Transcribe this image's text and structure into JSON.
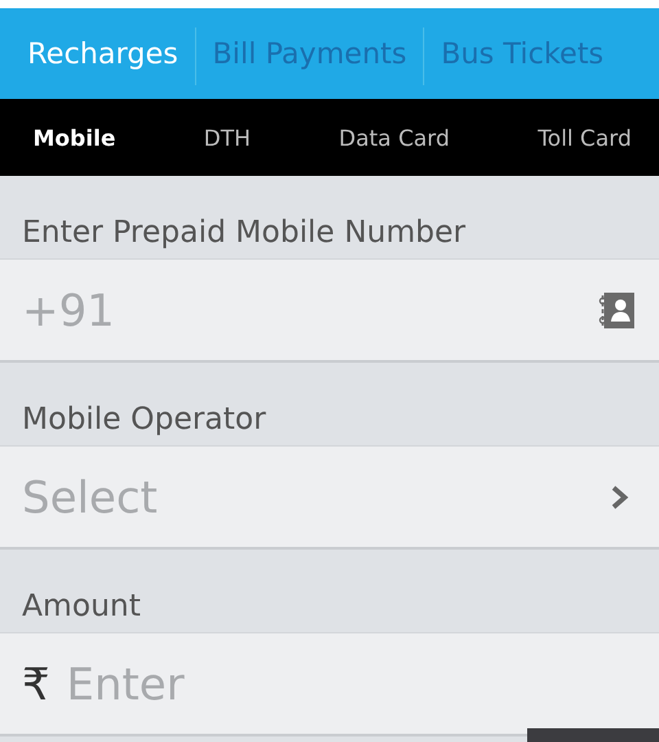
{
  "tabs": [
    {
      "label": "Recharges",
      "selected": true
    },
    {
      "label": "Bill Payments",
      "selected": false
    },
    {
      "label": "Bus Tickets",
      "selected": false
    }
  ],
  "subtabs": [
    {
      "label": "Mobile",
      "selected": true
    },
    {
      "label": "DTH",
      "selected": false
    },
    {
      "label": "Data Card",
      "selected": false
    },
    {
      "label": "Toll Card",
      "selected": false
    }
  ],
  "fields": [
    {
      "kind": "phone",
      "label": "Enter Prepaid Mobile Number",
      "placeholder": "+91"
    },
    {
      "kind": "select",
      "label": "Mobile Operator",
      "placeholder": "Select"
    },
    {
      "kind": "amount",
      "label": "Amount",
      "prefix": "₹",
      "placeholder": "Enter"
    }
  ]
}
